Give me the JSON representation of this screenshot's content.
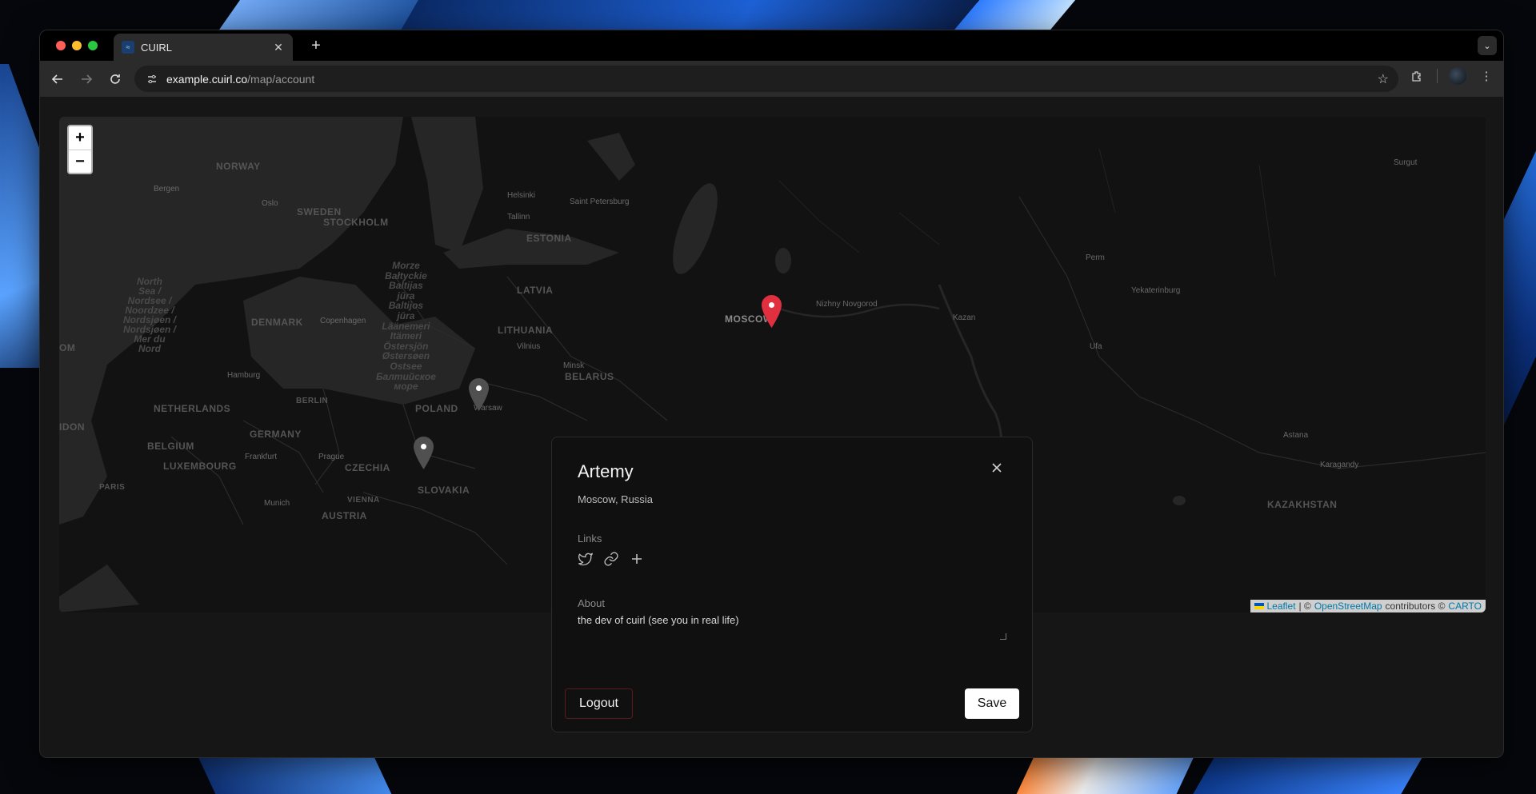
{
  "browser": {
    "tab_title": "CUIRL",
    "url_host": "example.cuirl.co",
    "url_path": "/map/account",
    "new_tab": "+"
  },
  "map": {
    "zoom_in": "+",
    "zoom_out": "−",
    "labels": {
      "norway": "NORWAY",
      "sweden": "SWEDEN",
      "stockholm": "STOCKHOLM",
      "estonia": "ESTONIA",
      "latvia": "LATVIA",
      "lithuania": "LITHUANIA",
      "denmark": "DENMARK",
      "netherlands": "NETHERLANDS",
      "germany": "GERMANY",
      "belgium": "BELGIUM",
      "luxembourg": "LUXEMBOURG",
      "poland": "POLAND",
      "czechia": "CZECHIA",
      "slovakia": "SLOVAKIA",
      "austria": "AUSTRIA",
      "belarus": "BELARUS",
      "kazakhstan": "KAZAKHSTAN",
      "moscow": "MOSCOW",
      "bergen": "Bergen",
      "oslo": "Oslo",
      "helsinki": "Helsinki",
      "tallinn": "Tallinn",
      "saint_petersburg": "Saint Petersburg",
      "copenhagen": "Copenhagen",
      "hamburg": "Hamburg",
      "berlin": "BERLIN",
      "warsaw": "Warsaw",
      "vilnius": "Vilnius",
      "minsk": "Minsk",
      "frankfurt": "Frankfurt",
      "prague": "Prague",
      "munich": "Munich",
      "vienna": "VIENNA",
      "paris": "PARIS",
      "nizhny": "Nizhny Novgorod",
      "kazan": "Kazan",
      "perm": "Perm",
      "yekaterinburg": "Yekaterinburg",
      "ufa": "Ufa",
      "surgut": "Surgut",
      "astana": "Astana",
      "karagandy": "Karagandy",
      "north_sea": "North\nSea /\nNordsee /\nNoordzee /\nNordsjøen /\nNordsjøen /\nMer du\nNord",
      "baltic_sea": "Morze\nBałtyckie\nBaltijas\njūra\nBaltijos\njūra\nLäänemeri\nItämeri\nÖstersjön\nØstersøen\nOstsee\nБалтийское\nморе",
      "om": "OM",
      "idon": "IDON"
    },
    "attribution": {
      "leaflet": "Leaflet",
      "sep": "| ©",
      "osm": "OpenStreetMap",
      "contributors": "contributors ©",
      "carto": "CARTO"
    }
  },
  "profile": {
    "name": "Artemy",
    "location": "Moscow, Russia",
    "links_label": "Links",
    "about_label": "About",
    "about_text": "the dev of cuirl (see you in real life)",
    "logout": "Logout",
    "save": "Save"
  }
}
